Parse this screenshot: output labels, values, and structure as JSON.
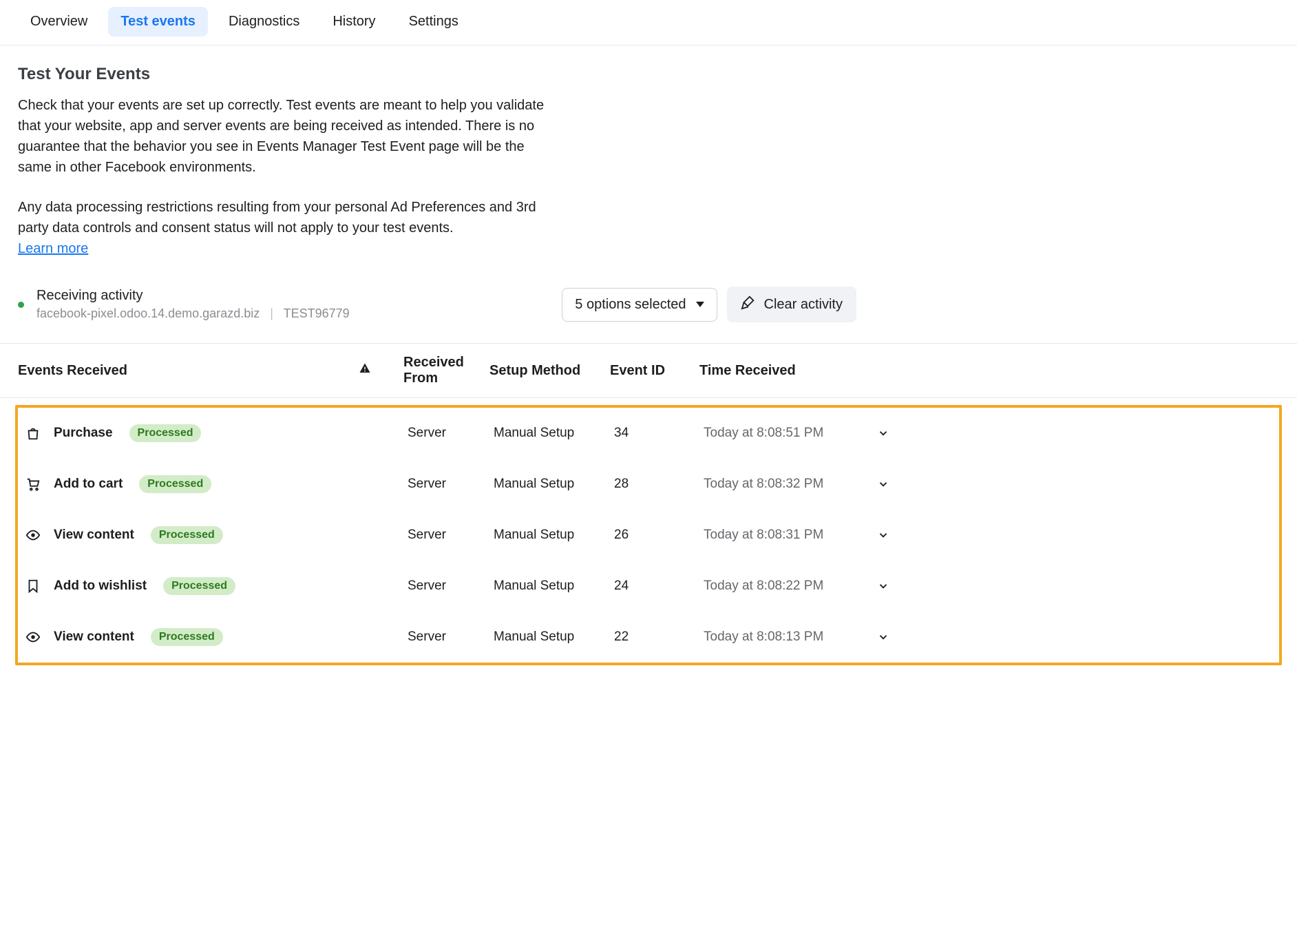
{
  "tabs": {
    "overview": "Overview",
    "test_events": "Test events",
    "diagnostics": "Diagnostics",
    "history": "History",
    "settings": "Settings"
  },
  "heading": "Test Your Events",
  "description_p1": "Check that your events are set up correctly. Test events are meant to help you validate that your website, app and server events are being received as intended. There is no guarantee that the behavior you see in Events Manager Test Event page will be the same in other Facebook environments.",
  "description_p2": "Any data processing restrictions resulting from your personal Ad Preferences and 3rd party data controls and consent status will not apply to your test events.",
  "learn_more": "Learn more",
  "activity": {
    "title": "Receiving activity",
    "domain": "facebook-pixel.odoo.14.demo.garazd.biz",
    "test_id": "TEST96779"
  },
  "filter_label": "5 options selected",
  "clear_label": "Clear activity",
  "columns": {
    "events_received": "Events Received",
    "received_from": "Received From",
    "setup_method": "Setup Method",
    "event_id": "Event ID",
    "time_received": "Time Received"
  },
  "events": [
    {
      "icon": "bag",
      "name": "Purchase",
      "status": "Processed",
      "from": "Server",
      "method": "Manual Setup",
      "id": "34",
      "time": "Today at 8:08:51 PM"
    },
    {
      "icon": "cart",
      "name": "Add to cart",
      "status": "Processed",
      "from": "Server",
      "method": "Manual Setup",
      "id": "28",
      "time": "Today at 8:08:32 PM"
    },
    {
      "icon": "eye",
      "name": "View content",
      "status": "Processed",
      "from": "Server",
      "method": "Manual Setup",
      "id": "26",
      "time": "Today at 8:08:31 PM"
    },
    {
      "icon": "bookmark",
      "name": "Add to wishlist",
      "status": "Processed",
      "from": "Server",
      "method": "Manual Setup",
      "id": "24",
      "time": "Today at 8:08:22 PM"
    },
    {
      "icon": "eye",
      "name": "View content",
      "status": "Processed",
      "from": "Server",
      "method": "Manual Setup",
      "id": "22",
      "time": "Today at 8:08:13 PM"
    }
  ]
}
